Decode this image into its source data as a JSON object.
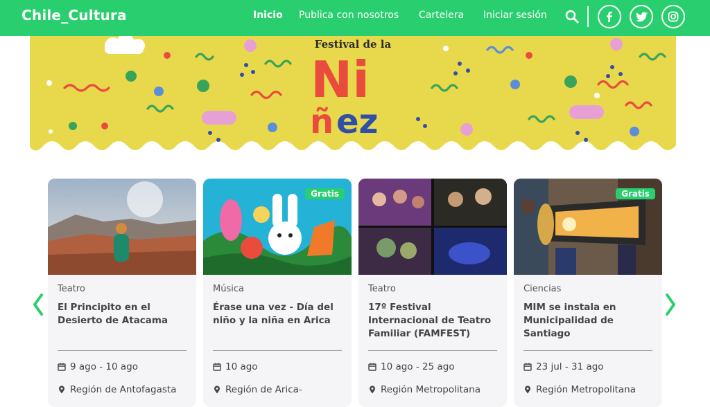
{
  "header": {
    "logo": "Chile_Cultura",
    "nav": {
      "home": "Inicio",
      "publish": "Publica con nosotros",
      "billboard": "Cartelera",
      "login": "Iniciar sesión"
    },
    "icons": [
      "search-icon",
      "facebook-icon",
      "twitter-icon",
      "instagram-icon"
    ],
    "brand_color": "#29cf6e"
  },
  "banner": {
    "title_line": "Festival de la",
    "title_word_parts": [
      "Ni",
      "ñ",
      "ez"
    ],
    "background_color": "#e8d94c"
  },
  "cards": [
    {
      "category": "Teatro",
      "title": "El Principito en el Desierto de Atacama",
      "date": "9 ago - 10 ago",
      "region": "Región de Antofagasta",
      "badge": ""
    },
    {
      "category": "Música",
      "title": "Érase una vez - Día del niño y la niña en Arica",
      "date": "10 ago",
      "region": "Región de Arica-",
      "badge": "Gratis"
    },
    {
      "category": "Teatro",
      "title": "17º Festival Internacional de Teatro Familiar (FAMFEST)",
      "date": "10 ago - 25 ago",
      "region": "Región Metropolitana",
      "badge": ""
    },
    {
      "category": "Ciencias",
      "title": "MIM se instala en Municipalidad de Santiago",
      "date": "23 jul - 31 ago",
      "region": "Región Metropolitana",
      "badge": "Gratis"
    }
  ],
  "colors": {
    "accent": "#29cf6e",
    "card_bg": "#f5f5f7",
    "text": "#444444"
  }
}
